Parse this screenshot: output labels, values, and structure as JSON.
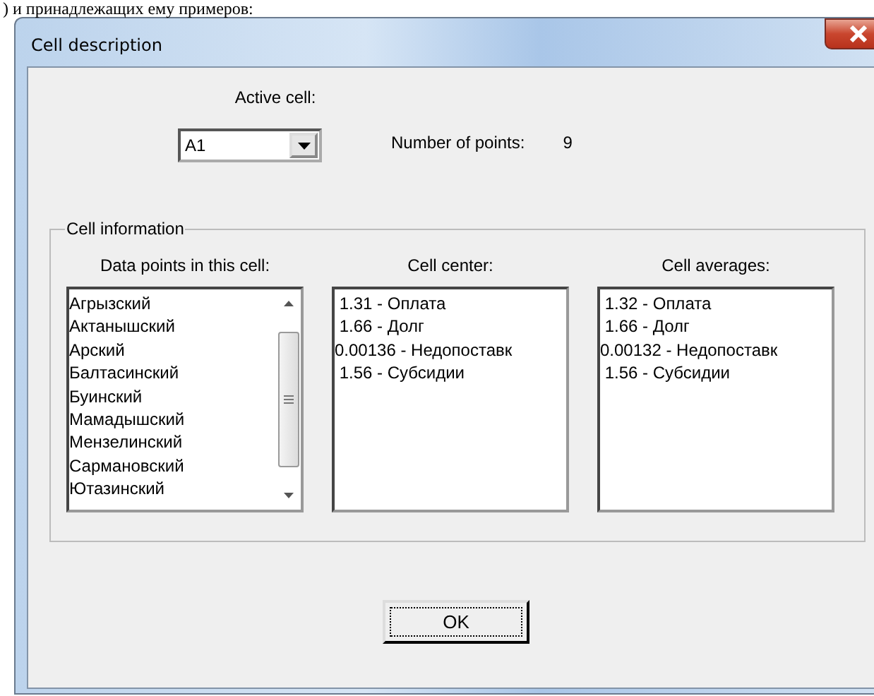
{
  "document_text": ") и принадлежащих ему примеров:",
  "window": {
    "title": "Cell description"
  },
  "active_cell": {
    "label": "Active cell:",
    "value": "A1"
  },
  "number_of_points": {
    "label": "Number of points:",
    "value": "9"
  },
  "cell_information": {
    "title": "Cell information",
    "lists": [
      {
        "heading": "Data points in this cell:",
        "scrollbar": true,
        "items": [
          "Агрызский",
          "Актанышский",
          "Арский",
          "Балтасинский",
          "Буинский",
          "Мамадышский",
          "Мензелинский",
          "Сармановский",
          "Ютазинский"
        ]
      },
      {
        "heading": "Cell center:",
        "scrollbar": false,
        "items": [
          " 1.31 - Оплата",
          " 1.66 - Долг",
          "0.00136 - Недопоставк",
          " 1.56 - Субсидии"
        ]
      },
      {
        "heading": "Cell averages:",
        "scrollbar": false,
        "items": [
          " 1.32 - Оплата",
          " 1.66 - Долг",
          "0.00132 - Недопоставк",
          " 1.56 - Субсидии"
        ]
      }
    ]
  },
  "buttons": [
    {
      "label": "OK",
      "focused": true
    }
  ]
}
